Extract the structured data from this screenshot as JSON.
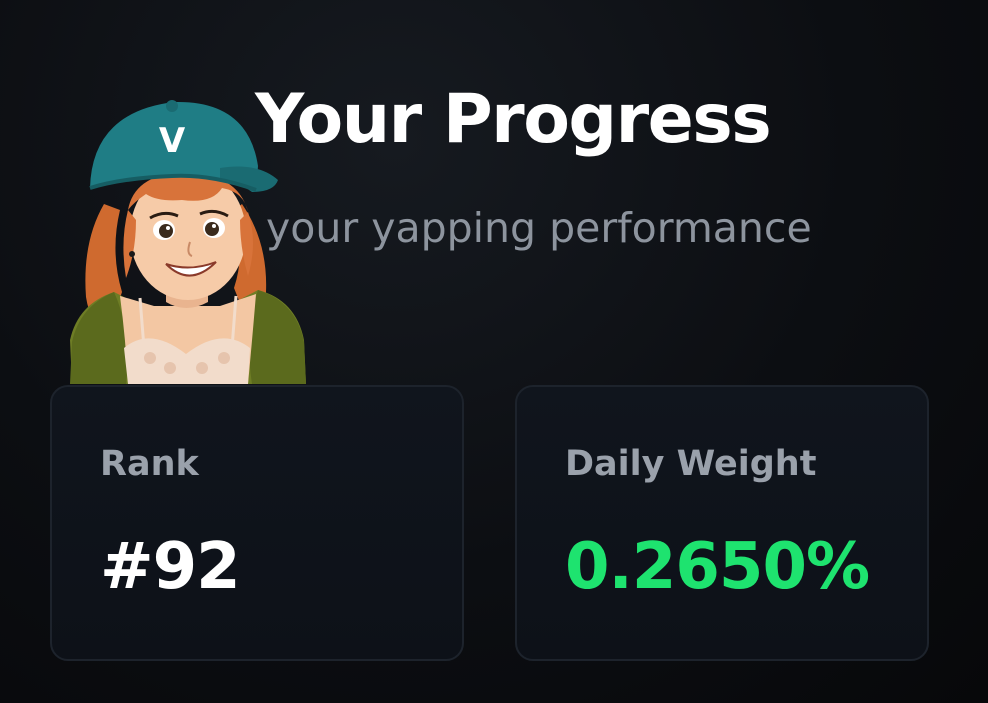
{
  "header": {
    "title": "Your Progress",
    "subtitle": "your yapping performance"
  },
  "avatar": {
    "icon": "cartoon-girl-avatar",
    "cap_logo": "V",
    "cap_color": "#1f7d85"
  },
  "stats": {
    "rank": {
      "label": "Rank",
      "value": "#92"
    },
    "daily_weight": {
      "label": "Daily Weight",
      "value": "0.2650%",
      "color": "#1ee36f"
    }
  }
}
